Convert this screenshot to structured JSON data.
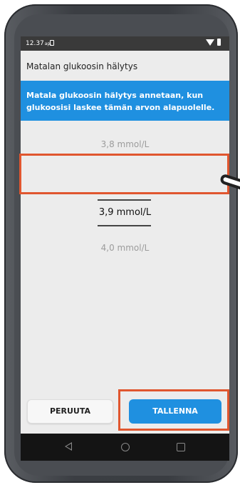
{
  "status_bar": {
    "time": "12.37",
    "time_suffix": "ap."
  },
  "header": {
    "title": "Matalan glukoosin hälytys"
  },
  "info": {
    "text": "Matala glukoosin hälytys annetaan, kun glukoosisi laskee tämän arvon alapuolelle."
  },
  "picker": {
    "previous": "3,8 mmol/L",
    "selected": "3,9 mmol/L",
    "next": "4,0 mmol/L"
  },
  "buttons": {
    "cancel": "PERUUTA",
    "save": "TALLENNA"
  },
  "colors": {
    "accent": "#1f90e0",
    "highlight": "#e0562f"
  }
}
